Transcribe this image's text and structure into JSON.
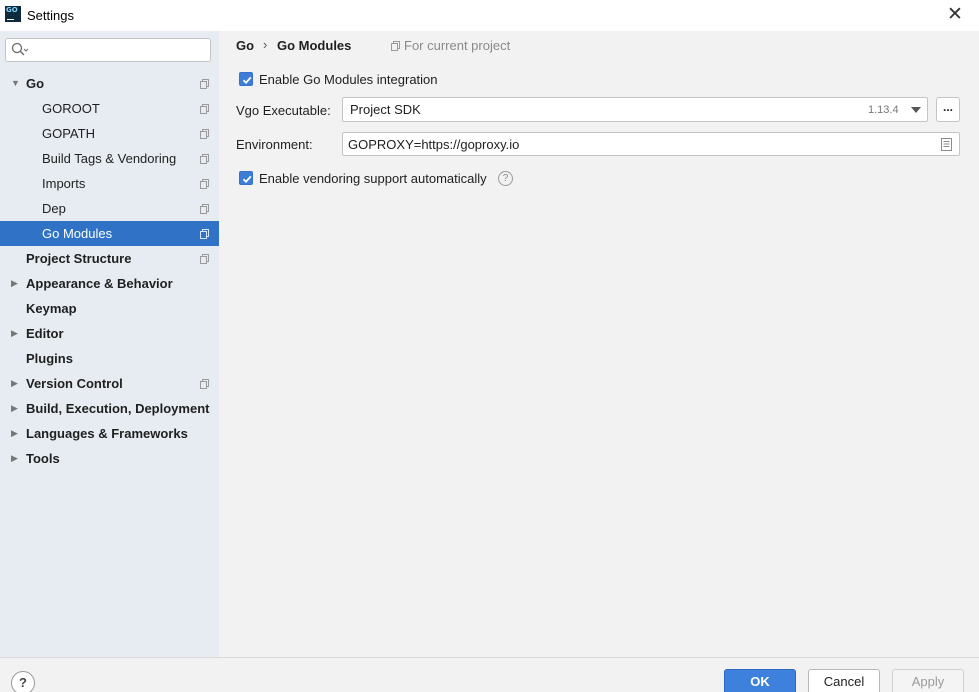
{
  "window": {
    "title": "Settings",
    "app_icon_text": "GO",
    "close_symbol": "✕"
  },
  "sidebar": {
    "search": {
      "placeholder": "",
      "value": ""
    },
    "items": [
      {
        "label": "Go",
        "bold": true,
        "expanded": true,
        "icon": "copy-icon"
      },
      {
        "label": "GOROOT",
        "icon": "copy-icon"
      },
      {
        "label": "GOPATH",
        "icon": "copy-icon"
      },
      {
        "label": "Build Tags & Vendoring",
        "icon": "copy-icon"
      },
      {
        "label": "Imports",
        "icon": "copy-icon"
      },
      {
        "label": "Dep",
        "icon": "copy-icon"
      },
      {
        "label": "Go Modules",
        "selected": true,
        "icon": "copy-icon"
      },
      {
        "label": "Project Structure",
        "bold": true,
        "icon": "copy-icon"
      },
      {
        "label": "Appearance & Behavior",
        "bold": true,
        "collapsed": true
      },
      {
        "label": "Keymap",
        "bold": true
      },
      {
        "label": "Editor",
        "bold": true,
        "collapsed": true
      },
      {
        "label": "Plugins",
        "bold": true
      },
      {
        "label": "Version Control",
        "bold": true,
        "collapsed": true,
        "icon": "copy-icon"
      },
      {
        "label": "Build, Execution, Deployment",
        "bold": true,
        "collapsed": true
      },
      {
        "label": "Languages & Frameworks",
        "bold": true,
        "collapsed": true
      },
      {
        "label": "Tools",
        "bold": true,
        "collapsed": true
      }
    ]
  },
  "main": {
    "breadcrumb": {
      "parent": "Go",
      "separator": "›",
      "current": "Go Modules"
    },
    "scope_label": "For current project",
    "enable_modules": {
      "label": "Enable Go Modules integration",
      "checked": true
    },
    "vgo": {
      "label": "Vgo Executable:",
      "value": "Project SDK",
      "version": "1.13.4",
      "browse_label": "..."
    },
    "environment": {
      "label": "Environment:",
      "value": "GOPROXY=https://goproxy.io"
    },
    "enable_vendoring": {
      "label": "Enable vendoring support automatically",
      "checked": true,
      "help": "?"
    }
  },
  "footer": {
    "help": "?",
    "ok": "OK",
    "cancel": "Cancel",
    "apply": "Apply"
  },
  "colors": {
    "selection": "#2f72c6",
    "sidebar_bg": "#e7ecf3",
    "primary_button": "#3d81dd",
    "checkbox": "#3d7dd8"
  }
}
